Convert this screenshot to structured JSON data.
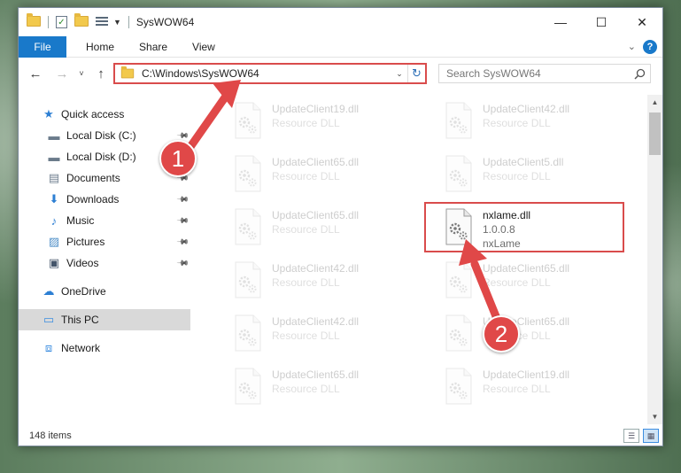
{
  "window": {
    "title": "SysWOW64",
    "minimize_glyph": "—",
    "maximize_glyph": "☐",
    "close_glyph": "✕"
  },
  "ribbon": {
    "tabs": [
      "File",
      "Home",
      "Share",
      "View"
    ],
    "help_glyph": "?"
  },
  "navbar": {
    "back_glyph": "←",
    "forward_glyph": "→",
    "recent_glyph": "˅",
    "up_glyph": "↑",
    "address_path": "C:\\Windows\\SysWOW64",
    "refresh_glyph": "↻",
    "search_placeholder": "Search SysWOW64"
  },
  "sidebar": {
    "items": [
      {
        "label": "Quick access",
        "icon": "star-icon",
        "pinned": false
      },
      {
        "label": "Local Disk (C:)",
        "icon": "drive-icon",
        "pinned": true
      },
      {
        "label": "Local Disk (D:)",
        "icon": "drive-icon",
        "pinned": false
      },
      {
        "label": "Documents",
        "icon": "documents-icon",
        "pinned": true
      },
      {
        "label": "Downloads",
        "icon": "download-icon",
        "pinned": true
      },
      {
        "label": "Music",
        "icon": "music-icon",
        "pinned": true
      },
      {
        "label": "Pictures",
        "icon": "pictures-icon",
        "pinned": true
      },
      {
        "label": "Videos",
        "icon": "videos-icon",
        "pinned": true
      },
      {
        "label": "OneDrive",
        "icon": "cloud-icon",
        "pinned": false
      },
      {
        "label": "This PC",
        "icon": "computer-icon",
        "pinned": false,
        "selected": true
      },
      {
        "label": "Network",
        "icon": "network-icon",
        "pinned": false
      }
    ]
  },
  "files": [
    {
      "name": "UpdateClient19.dll",
      "line2": "Resource DLL",
      "line3": "",
      "faded": true
    },
    {
      "name": "UpdateClient42.dll",
      "line2": "Resource DLL",
      "line3": "",
      "faded": true
    },
    {
      "name": "UpdateClient65.dll",
      "line2": "Resource DLL",
      "line3": "",
      "faded": true
    },
    {
      "name": "UpdateClient5.dll",
      "line2": "Resource DLL",
      "line3": "",
      "faded": true
    },
    {
      "name": "UpdateClient65.dll",
      "line2": "Resource DLL",
      "line3": "",
      "faded": true
    },
    {
      "name": "nxlame.dll",
      "line2": "1.0.0.8",
      "line3": "nxLame",
      "faded": false
    },
    {
      "name": "UpdateClient42.dll",
      "line2": "Resource DLL",
      "line3": "",
      "faded": true
    },
    {
      "name": "UpdateClient65.dll",
      "line2": "Resource DLL",
      "line3": "",
      "faded": true
    },
    {
      "name": "UpdateClient42.dll",
      "line2": "Resource DLL",
      "line3": "",
      "faded": true
    },
    {
      "name": "UpdateClient65.dll",
      "line2": "Resource DLL",
      "line3": "",
      "faded": true
    },
    {
      "name": "UpdateClient65.dll",
      "line2": "Resource DLL",
      "line3": "",
      "faded": true
    },
    {
      "name": "UpdateClient19.dll",
      "line2": "Resource DLL",
      "line3": "",
      "faded": true
    }
  ],
  "status": {
    "item_count": "148 items"
  },
  "annotations": {
    "badge_1": "1",
    "badge_2": "2",
    "color": "#e04848"
  }
}
